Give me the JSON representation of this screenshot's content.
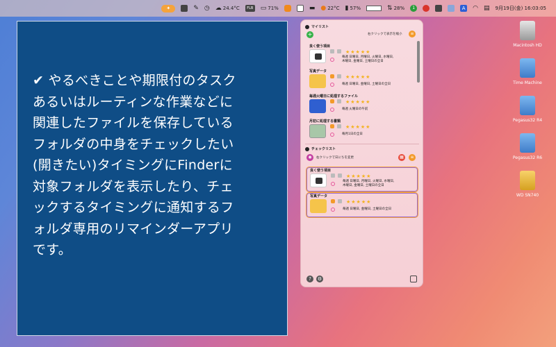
{
  "menubar": {
    "temperature": "24.4°C",
    "badge_text": "FLB",
    "percent1": "71%",
    "temp2": "22°C",
    "percent2": "57%",
    "percent3": "28%",
    "green_badge": "1",
    "letter_icon": "A",
    "datetime": "9月19日(金) 16:03:05"
  },
  "text_panel": {
    "body": "✔ やるべきことや期限付のタスク\nあるいはルーティンな作業などに\n関連したファイルを保存している\nフォルダの中身をチェックしたい\n(開きたい)タイミングにFinderに\n対象フォルダを表示したり、チェ\nックするタイミングに通知するフ\nォルダ専用のリマインダーアプリ\nです。"
  },
  "app": {
    "mylist_title": "マイリスト",
    "mylist_hint": "右クリックで表示を縮小",
    "items": [
      {
        "title": "良く使う項目",
        "schedule": "毎週 日曜日, 月曜日, 火曜日, 水曜日,\n木曜日, 金曜日, 土曜日の全日"
      },
      {
        "title": "写真データ",
        "schedule": "毎週 日曜日, 金曜日, 土曜日の全日"
      },
      {
        "title": "毎週火曜日に処理するファイル",
        "schedule": "毎週 火曜日の午前"
      },
      {
        "title": "月初に処理する書類",
        "schedule": "毎月1日の全日"
      }
    ],
    "checklist_title": "チェックリスト",
    "checklist_hint": "右クリックで日にちを変更",
    "checklist_items": [
      {
        "title": "良く使う項目",
        "schedule": "毎週 日曜日, 月曜日, 火曜日, 水曜日,\n木曜日, 金曜日, 土曜日の全日"
      },
      {
        "title": "写真データ",
        "schedule": "毎週 日曜日, 金曜日, 土曜日の全日"
      }
    ],
    "stars": "★★★★★"
  },
  "desktop": {
    "icons": [
      {
        "label": "Macintosh HD"
      },
      {
        "label": "Time Machine"
      },
      {
        "label": "Pegasus32 R4"
      },
      {
        "label": "Pegasus32 R6"
      },
      {
        "label": "WD SN740"
      }
    ]
  }
}
